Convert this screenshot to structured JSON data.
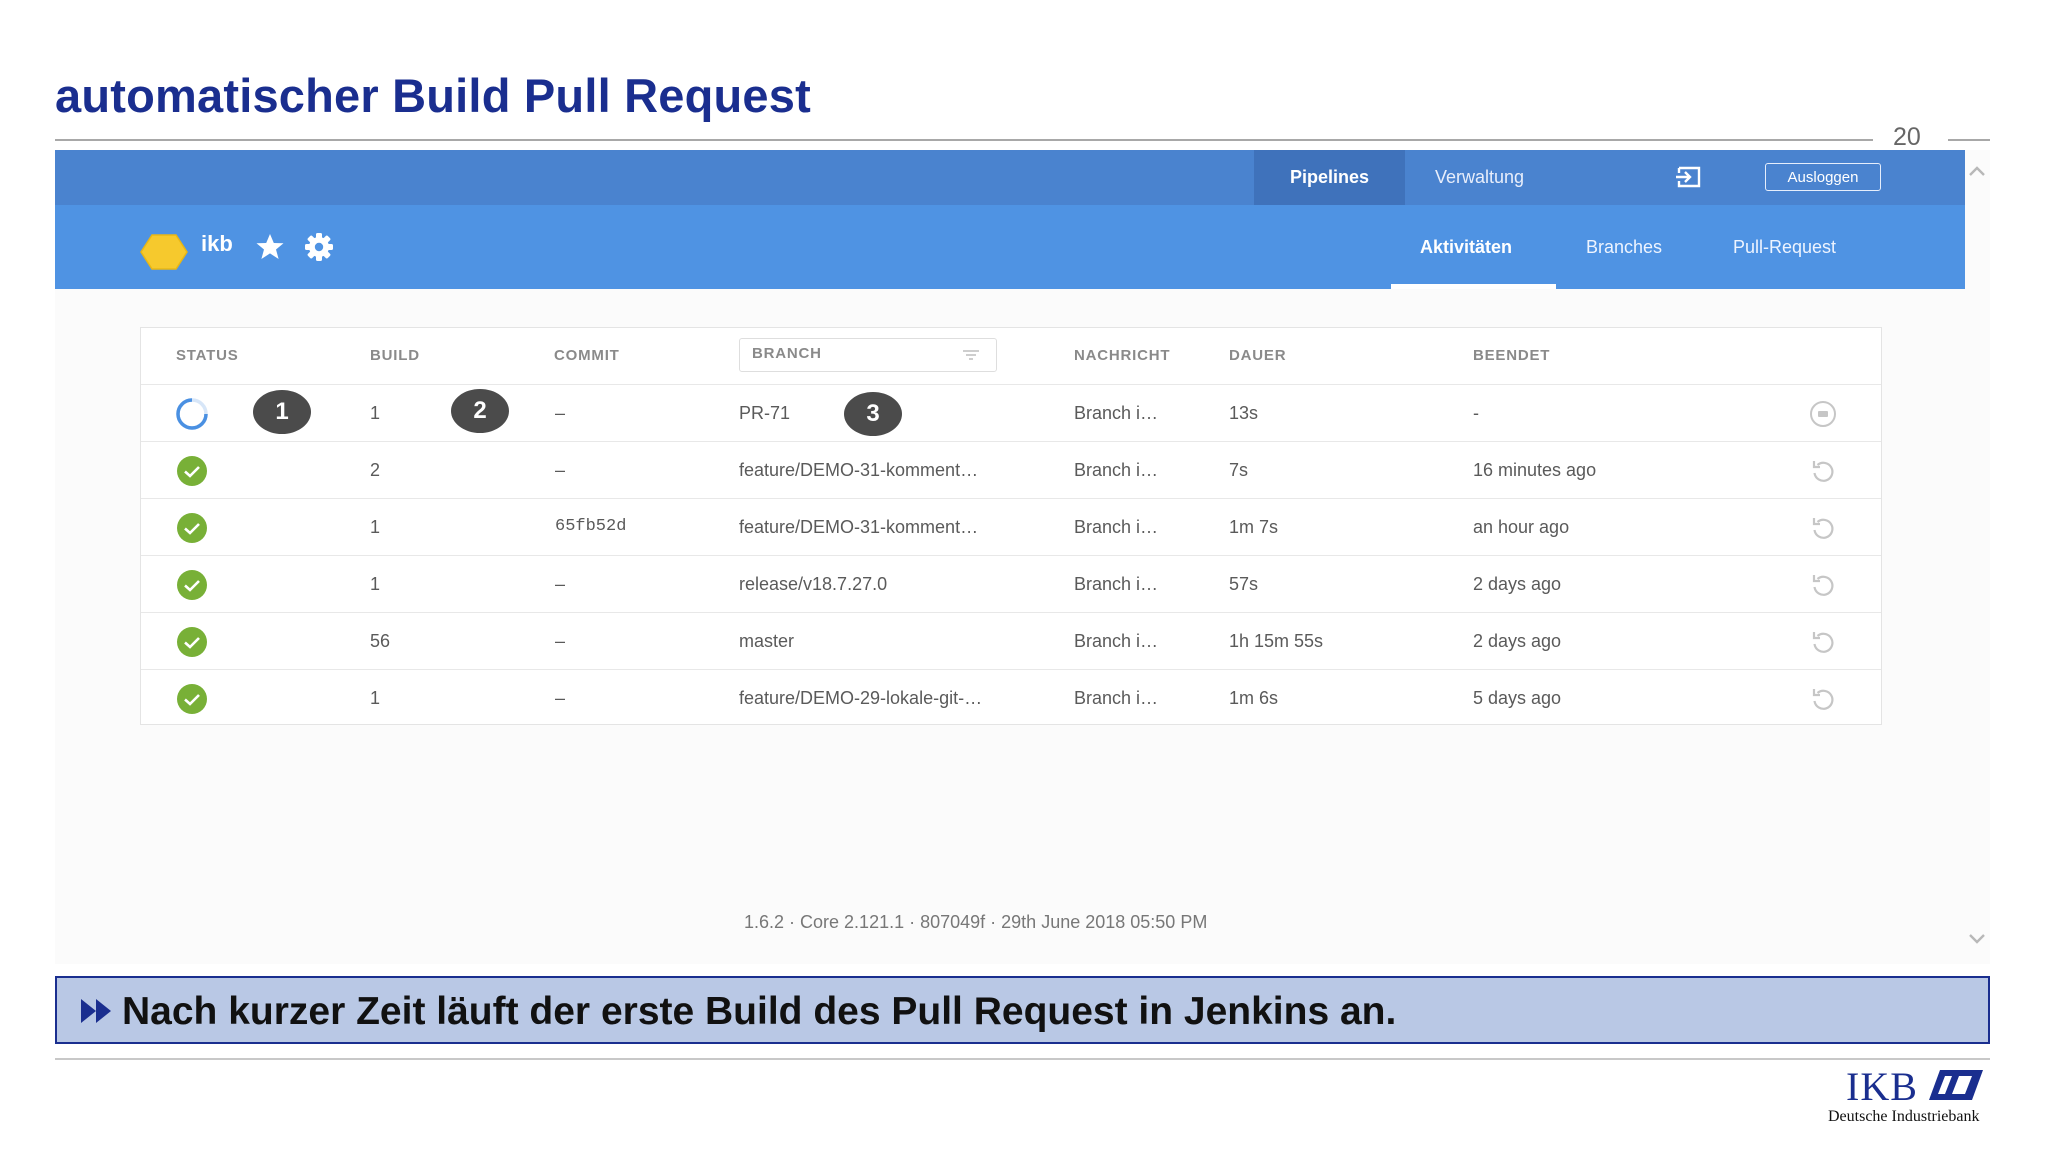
{
  "slide": {
    "title": "automatischer Build Pull Request",
    "page_number": "20",
    "summary": "Nach kurzer Zeit läuft der erste Build des Pull Request in Jenkins an.",
    "logo_text": "IKB",
    "logo_subline": "Deutsche Industriebank",
    "brand_color": "#1a2e8f"
  },
  "app": {
    "topnav": {
      "pipelines": "Pipelines",
      "verwaltung": "Verwaltung",
      "logout": "Ausloggen"
    },
    "pipeline": {
      "name": "ikb"
    },
    "tabs": {
      "activities": "Aktivitäten",
      "branches": "Branches",
      "pull_requests": "Pull-Request"
    },
    "colors": {
      "topbar": "#4a83cf",
      "subbar": "#4f93e3",
      "success": "#78b037",
      "running": "#4a90e2"
    },
    "table": {
      "headers": {
        "status": "STATUS",
        "build": "BUILD",
        "commit": "COMMIT",
        "branch": "BRANCH",
        "message": "NACHRICHT",
        "duration": "DAUER",
        "finished": "BEENDET"
      },
      "rows": [
        {
          "status": "running",
          "build": "1",
          "commit": "–",
          "branch": "PR-71",
          "message": "Branch i…",
          "duration": "13s",
          "finished": "-",
          "action": "stop-icon"
        },
        {
          "status": "success",
          "build": "2",
          "commit": "–",
          "branch": "feature/DEMO-31-komment…",
          "message": "Branch i…",
          "duration": "7s",
          "finished": "16 minutes ago",
          "action": "rerun-icon"
        },
        {
          "status": "success",
          "build": "1",
          "commit": "65fb52d",
          "branch": "feature/DEMO-31-komment…",
          "message": "Branch i…",
          "duration": "1m 7s",
          "finished": "an hour ago",
          "action": "rerun-icon"
        },
        {
          "status": "success",
          "build": "1",
          "commit": "–",
          "branch": "release/v18.7.27.0",
          "message": "Branch i…",
          "duration": "57s",
          "finished": "2 days ago",
          "action": "rerun-icon"
        },
        {
          "status": "success",
          "build": "56",
          "commit": "–",
          "branch": "master",
          "message": "Branch i…",
          "duration": "1h 15m 55s",
          "finished": "2 days ago",
          "action": "rerun-icon"
        },
        {
          "status": "success",
          "build": "1",
          "commit": "–",
          "branch": "feature/DEMO-29-lokale-git-…",
          "message": "Branch i…",
          "duration": "1m 6s",
          "finished": "5 days ago",
          "action": "rerun-icon"
        }
      ]
    },
    "callouts": [
      "1",
      "2",
      "3"
    ],
    "footer": "1.6.2 · Core 2.121.1 · 807049f · 29th June 2018 05:50 PM"
  }
}
